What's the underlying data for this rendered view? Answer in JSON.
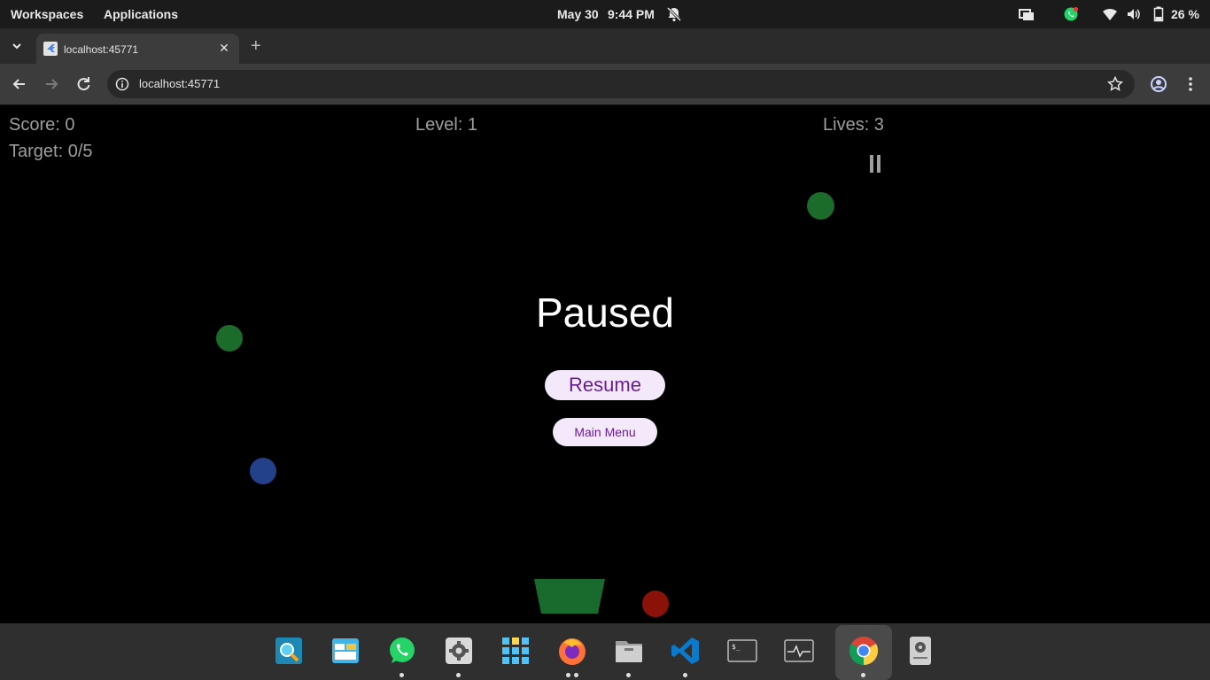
{
  "system_bar": {
    "workspaces": "Workspaces",
    "applications": "Applications",
    "date": "May 30",
    "time": "9:44 PM",
    "battery": "26 %"
  },
  "browser": {
    "tab_title": "localhost:45771",
    "url": "localhost:45771"
  },
  "game": {
    "score": "Score: 0",
    "target": "Target: 0/5",
    "level": "Level: 1",
    "lives": "Lives: 3",
    "pause_icon": "pause-icon",
    "paused_title": "Paused",
    "resume_label": "Resume",
    "main_menu_label": "Main Menu",
    "colors": {
      "green_ball": "#1b6b2a",
      "blue_ball": "#23408a",
      "red_ball": "#8a1208",
      "basket": "#196b2d",
      "button_bg": "#f3e9fb",
      "button_text": "#6a1b9a"
    }
  },
  "dock": {
    "apps": [
      "search-app-icon",
      "screenshot-app-icon",
      "whatsapp-icon",
      "settings-icon",
      "app-grid-icon",
      "firefox-icon",
      "files-icon",
      "vscode-icon",
      "terminal-icon",
      "system-monitor-icon",
      "chrome-icon",
      "disk-icon"
    ]
  }
}
